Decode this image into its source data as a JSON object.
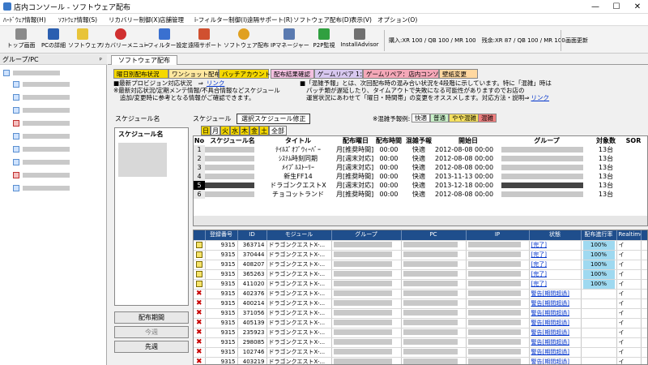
{
  "window": {
    "title": "店内コンソール - ソフトウェア配布",
    "minimize": "—",
    "maximize": "☐",
    "close": "✕"
  },
  "menu": [
    "ﾊｰﾄﾞｳｪｱ情報(H)",
    "ｿﾌﾄｳｪｱ情報(S)",
    "リカバリー制御(X)",
    "店舗管理",
    "i-フィルター制御(I)",
    "遠隔サポート(R)",
    "ソフトウェア配布(D)",
    "表示(V)",
    "オプション(O)"
  ],
  "toolbar": {
    "buttons": [
      "トップ画面",
      "PCの詳細",
      "ソフトウェア",
      "リカバリーメニュー",
      "i-フィルター設定",
      "遠隔サポート",
      "ソフトウェア配布",
      "IPマネージャー",
      "P2P監視",
      "InstallAdvisor"
    ],
    "info": "購入:XR 100 / QB 100 / MR 100　残余:XR 87 / QB 100 / MR 100",
    "refresh": "画面更新"
  },
  "left": {
    "header": "グループ/PC",
    "pin": "ᵖ"
  },
  "maintab": "ソフトウェア配布",
  "subtabs": [
    {
      "label": "曜日別配布状況",
      "color": "#f5d800"
    },
    {
      "label": "ワンショット配布",
      "color": "#ffe8a0"
    },
    {
      "label": "バッチアカウント登録",
      "color": "#f5d800"
    },
    {
      "label": "配布結果確認",
      "color": "#f3c0e0"
    },
    {
      "label": "ゲームリペア 1：1",
      "color": "#d8c8f0"
    },
    {
      "label": "ゲームリペア：店内コンソール",
      "color": "#f5a8b8"
    },
    {
      "label": "壁紙変更",
      "color": "#ffd8a0"
    }
  ],
  "notes": {
    "n1": "■最新プロビジョン対応状況　⇒",
    "n1link": "リンク",
    "n2": "※最新対応状況/定期メンテ情報/不具合情報などスケジュール",
    "n3": "追加/変更時に参考となる情報がご確認できます。",
    "n4": "■「混雑予報」とは、次回配布時の混み合い状況を4段階に示しています。特に「混雑」時は",
    "n5": "パッチ類が遅延したり、タイムアウトで失敗になる可能性がありますのでお店の",
    "n6": "運営状況にあわせて「曜日・時間帯」の変更をオススメします。対応方法・説明⇒",
    "n6link": "リンク"
  },
  "schedule": {
    "label1": "スケジュール名",
    "label2": "スケジュール",
    "modify": "選択スケジュール修正",
    "listhead": "スケジュール名",
    "legend_label": "※混雑予報例:",
    "legend": [
      {
        "t": "快適",
        "c": "#ffffff"
      },
      {
        "t": "普通",
        "c": "#c8f0c8"
      },
      {
        "t": "やや混雑",
        "c": "#f5e060"
      },
      {
        "t": "混雑",
        "c": "#f08080"
      }
    ],
    "days": [
      {
        "t": "日",
        "c": "#f5d800"
      },
      {
        "t": "月",
        "c": "#ffffff"
      },
      {
        "t": "火",
        "c": "#f5d800"
      },
      {
        "t": "水",
        "c": "#f5d800"
      },
      {
        "t": "木",
        "c": "#f5d800"
      },
      {
        "t": "金",
        "c": "#f5d800"
      },
      {
        "t": "土",
        "c": "#f5d800"
      },
      {
        "t": "全部",
        "c": "#ffffff"
      }
    ],
    "buttons": [
      "配布期間",
      "今週",
      "先週"
    ]
  },
  "grid1": {
    "headers": [
      "No",
      "スケジュール名",
      "タイトル",
      "配布曜日",
      "配布時間",
      "混雑予報",
      "開始日",
      "グループ",
      "対象数",
      "SOR"
    ],
    "rows": [
      {
        "no": "1",
        "title": "ﾃｲﾙｽﾞｵﾌﾞｳｨｰﾊﾞｰ",
        "day": "月[推奨時間]",
        "time": "00:00",
        "fc": "快適",
        "start": "2012-08-08 00:00",
        "count": "13台"
      },
      {
        "no": "2",
        "title": "ｼｽﾃﾑ時刻同期",
        "day": "月[週末対応]",
        "time": "00:00",
        "fc": "快適",
        "start": "2012-08-08 00:00",
        "count": "13台"
      },
      {
        "no": "3",
        "title": "ﾒｲﾌﾟﾙｽﾄｰﾘｰ",
        "day": "月[週末対応]",
        "time": "00:00",
        "fc": "快適",
        "start": "2012-08-08 00:00",
        "count": "13台"
      },
      {
        "no": "4",
        "title": "新生FF14",
        "day": "月[推奨時間]",
        "time": "00:00",
        "fc": "快適",
        "start": "2013-11-13 00:00",
        "count": "13台"
      },
      {
        "no": "5",
        "title": "ドラゴンクエストX",
        "day": "月[週末対応]",
        "time": "00:00",
        "fc": "快適",
        "start": "2013-12-18 00:00",
        "count": "13台"
      },
      {
        "no": "6",
        "title": "チョコットランド",
        "day": "月[推奨時間]",
        "time": "00:00",
        "fc": "快適",
        "start": "2012-08-08 00:00",
        "count": "13台"
      }
    ]
  },
  "grid2": {
    "headers": [
      "",
      "登録番号",
      "ID",
      "モジュール",
      "グループ",
      "PC",
      "IP",
      "状態",
      "配布進行率",
      "Realtime",
      ""
    ],
    "rows": [
      {
        "icon": "ok",
        "reg": "9315",
        "id": "363714",
        "mod": "ドラゴンクエストX-...",
        "state": "[完了]",
        "pct": "100%",
        "rt": "イ"
      },
      {
        "icon": "ok",
        "reg": "9315",
        "id": "370444",
        "mod": "ドラゴンクエストX-...",
        "state": "[完了]",
        "pct": "100%",
        "rt": "イ"
      },
      {
        "icon": "ok",
        "reg": "9315",
        "id": "408207",
        "mod": "ドラゴンクエストX-...",
        "state": "[完了]",
        "pct": "100%",
        "rt": "イ"
      },
      {
        "icon": "ok",
        "reg": "9315",
        "id": "365263",
        "mod": "ドラゴンクエストX-...",
        "state": "[完了]",
        "pct": "100%",
        "rt": "イ"
      },
      {
        "icon": "ok",
        "reg": "9315",
        "id": "411020",
        "mod": "ドラゴンクエストX-...",
        "state": "[完了]",
        "pct": "100%",
        "rt": "イ"
      },
      {
        "icon": "ng",
        "reg": "9315",
        "id": "402376",
        "mod": "ドラゴンクエストX-...",
        "state": "警告[期間超過]",
        "pct": "",
        "rt": "イ"
      },
      {
        "icon": "ng",
        "reg": "9315",
        "id": "400214",
        "mod": "ドラゴンクエストX-...",
        "state": "警告[期間超過]",
        "pct": "",
        "rt": "イ"
      },
      {
        "icon": "ng",
        "reg": "9315",
        "id": "371056",
        "mod": "ドラゴンクエストX-...",
        "state": "警告[期間超過]",
        "pct": "",
        "rt": "イ"
      },
      {
        "icon": "ng",
        "reg": "9315",
        "id": "405139",
        "mod": "ドラゴンクエストX-...",
        "state": "警告[期間超過]",
        "pct": "",
        "rt": "イ"
      },
      {
        "icon": "ng",
        "reg": "9315",
        "id": "235923",
        "mod": "ドラゴンクエストX-...",
        "state": "警告[期間超過]",
        "pct": "",
        "rt": "イ"
      },
      {
        "icon": "ng",
        "reg": "9315",
        "id": "298085",
        "mod": "ドラゴンクエストX-...",
        "state": "警告[期間超過]",
        "pct": "",
        "rt": "イ"
      },
      {
        "icon": "ng",
        "reg": "9315",
        "id": "102746",
        "mod": "ドラゴンクエストX-...",
        "state": "警告[期間超過]",
        "pct": "",
        "rt": "イ"
      },
      {
        "icon": "ng",
        "reg": "9315",
        "id": "403219",
        "mod": "ドラゴンクエストX-...",
        "state": "警告[期間超過]",
        "pct": "",
        "rt": "イ"
      }
    ]
  }
}
